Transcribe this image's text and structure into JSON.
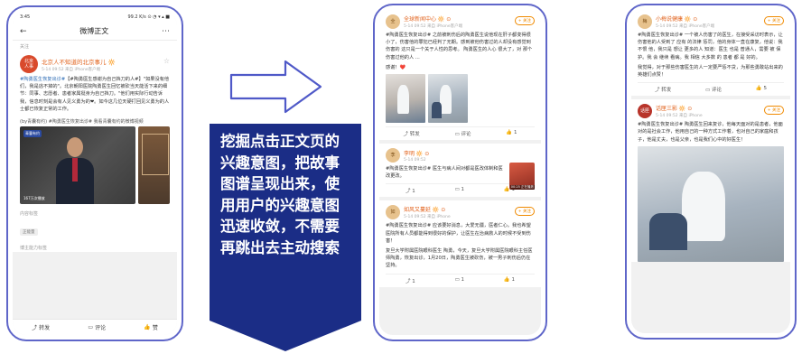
{
  "phone1": {
    "status": {
      "time": "3:45",
      "right": "99.2 K/s ⊙ ◔ ▾ ▴ ■"
    },
    "nav": {
      "title": "微博正文"
    },
    "follow_label": "关注",
    "post": {
      "avatar": "北京人不知道的北京事儿",
      "user": "北京人不知道的北京事儿 🔆",
      "meta": "5-14 09:52  来自 iPhone客户端",
      "text_tag": "#陶勇医生恢复出诊#",
      "text": "【#陶勇医生感谢为自己挡刀的人#】\"如果没有他们，我是逃不掉的\"。北京朝阳医院陶勇医生回忆被砍当天能活下来的细节：同事、志愿者、患者家属挺身为自己挡刀。\"他们用实际行动告诉我，信息时刻是会有人见义勇为的❤。如今这几位天硬打回见义勇为的人士都已恢复正常的工作。"
    },
    "video_title": "(by青囊有约)  #陶勇医生恢复出诊# 我看青囊有约的微博视频",
    "video_logo": "青囊有约",
    "video_time": "167万次播放",
    "content_label": "内容标签",
    "chip": "正能量",
    "blogger_label": "博主能力标签",
    "actions": {
      "share": "转发",
      "comment": "评论",
      "like": "赞"
    }
  },
  "arrow_icon": "right-arrow-icon",
  "banner": {
    "color": "#1b2d86",
    "text": "挖掘点击正文页的兴趣意图，把故事图谱呈现出来，使用用户的兴趣意图迅速收敛，不需要再跳出去主动搜索"
  },
  "phone2": {
    "cards": [
      {
        "user": "全球新闻中心 🔆 ⊙",
        "meta": "5-14 09:52 来自 iPhone客户端",
        "follow": "+ 关注",
        "text": "#陶勇医生恢复出诊# 之前被刺伤后的陶勇医生说他现在肝子都变得很小了，伤害他的罪犯已经判了无期。感到被他伤害过的人却没有感觉到 伤害的 这只是一个关于人性的思考。 陶勇医生的人心 很大了，对 那个伤害过他的人 ...",
        "caption": "感谢！❤️",
        "actions": {
          "share": "转发",
          "comment": "评论",
          "like": "1"
        }
      },
      {
        "user": "李明 🔆 ⊙",
        "meta": "5-14 09:52",
        "follow": "+ 关注",
        "text": "#陶勇医生恢复出诊# 医生与病人间对都是医改体制和医改更改。",
        "thumb_badge": "00:25 正在播放",
        "actions": {
          "share": "1",
          "comment": "1",
          "like": "1"
        }
      },
      {
        "user": "如风又蔓延 🔆 ⊙",
        "meta": "5-14 09:52 来自 iPhone",
        "follow": "+ 关注",
        "text": "#陶勇医生恢复出诊# 应该要好消息，大爱无疆，医者仁心。我也希望医院所有人员都能得到很好的保护，让医生在治病救人的时候不受到伤害！",
        "text2": "复旦大学附属医院眼科医生 陶勇，今天，复旦大学附属医院眼科主任医师陶勇，恢复出诊，1月20日，陶勇医生被砍伤，被一男子刺伤后仍在坚持。",
        "actions": {
          "share": "1",
          "comment": "1",
          "like": "1"
        }
      }
    ]
  },
  "phone3": {
    "cards": [
      {
        "user": "小梅说健康 🔆 ⊙",
        "meta": "5-14 09:52 来自 iPhone客户端",
        "follow": "+ 关注",
        "text": "#陶勇医生恢复出诊# 一个被人伤害了的医生，在接受采访时表示，让伤害他的人受到了 应有 的法律 惩罚，他的身体一直在康复，他说：我 不恨 他，我只是 想让 更多的人 知道：医生 也是 普通人，需要 被 保护。我 会 继续 看病。我 相信 大多数 的 患者 都 是 好的。",
        "text2": "我觉得，对于那些伤害医生的人一定要严惩不贷，为那些勇敢站出来的英雄们点赞！",
        "actions": {
          "share": "转发",
          "comment": "评论",
          "like": "5"
        }
      },
      {
        "user": "话匣三影 🔆 ⊙",
        "meta": "5-14 09:52 来自 iPhone",
        "follow": "+ 关注",
        "avatar": "话匣三影",
        "text": "#陶勇医生恢复出诊# 陶勇医生回来复诊，他每天面对的是患者，他面对的是社会工作，他用自己的一种方式工作着，也对自己的家庭和孩子，他是丈夫，也是父亲，也是我们心中的好医生！",
        "actions": {
          "share": "",
          "comment": "",
          "like": ""
        }
      }
    ]
  }
}
